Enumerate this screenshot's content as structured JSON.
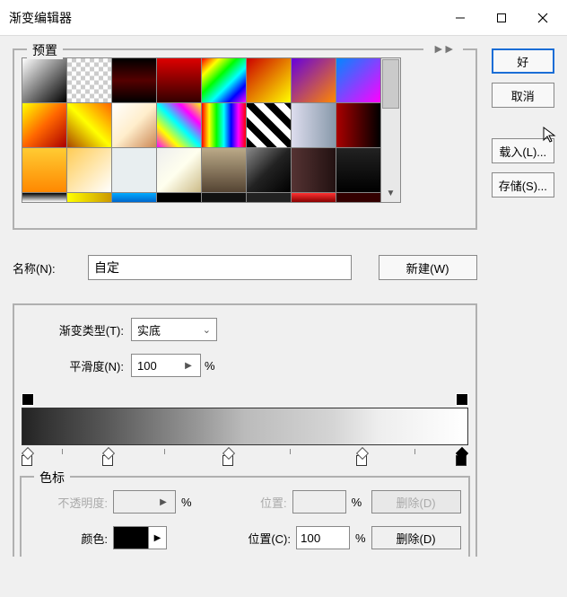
{
  "window": {
    "title": "渐变编辑器"
  },
  "buttons": {
    "ok": "好",
    "cancel": "取消",
    "load": "载入(L)...",
    "save": "存储(S)...",
    "new": "新建(W)"
  },
  "presets": {
    "label": "预置"
  },
  "name": {
    "label": "名称(N):",
    "value": "自定"
  },
  "gradientType": {
    "label": "渐变类型(T):",
    "value": "实底"
  },
  "smoothness": {
    "label": "平滑度(N):",
    "value": "100",
    "unit": "%"
  },
  "stops": {
    "label": "色标",
    "opacity": {
      "label": "不透明度:",
      "value": "",
      "unit": "%",
      "location_label": "位置:",
      "location_value": "",
      "delete": "删除(D)"
    },
    "color": {
      "label": "颜色:",
      "location_label": "位置(C):",
      "location_value": "100",
      "unit": "%",
      "delete": "删除(D)"
    }
  }
}
